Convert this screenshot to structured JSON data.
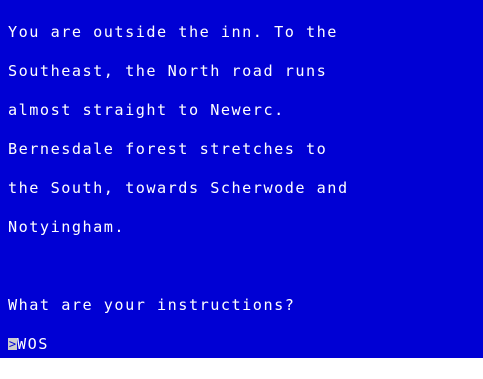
{
  "colors": {
    "background": "#0000d4",
    "text": "#ffffff",
    "cursor_bg": "#cdcdcd",
    "cursor_fg": "#0000d4"
  },
  "description_lines": [
    "You are outside the inn. To the",
    "Southeast, the North road runs",
    "almost straight to Newerc.",
    "Bernesdale forest stretches to",
    "the South, towards Scherwode and",
    "Notyingham."
  ],
  "prompt": "What are your instructions?",
  "input": {
    "cursor_glyph": ">",
    "typed_text": "WOS"
  }
}
